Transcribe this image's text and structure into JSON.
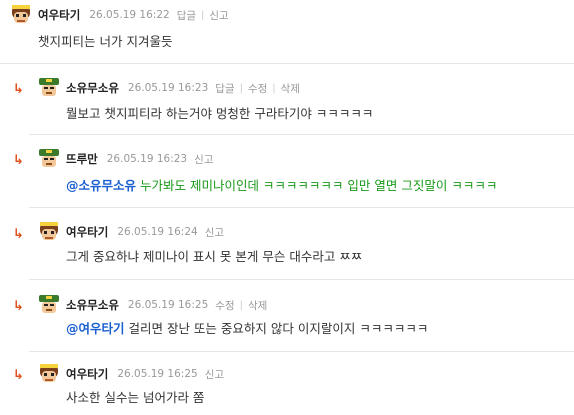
{
  "comments": [
    {
      "nick": "여우타기",
      "date": "26.05.19 16:22",
      "actions": [
        "답글",
        "신고"
      ],
      "text": "챗지피티는 너가 지겨울듯",
      "avatar": "fox"
    },
    {
      "nick": "소유무소유",
      "date": "26.05.19 16:23",
      "actions": [
        "답글",
        "수정",
        "삭제"
      ],
      "text": "뭘보고 챗지피티라 하는거야 멍청한 구라타기야 ㅋㅋㅋㅋㅋ",
      "avatar": "soldier"
    },
    {
      "nick": "뜨루만",
      "date": "26.05.19 16:23",
      "actions": [
        "신고"
      ],
      "mention": "@소유무소유",
      "text": " 누가봐도 제미나이인데 ㅋㅋㅋㅋㅋㅋㅋ 입만 열면 그짓말이 ㅋㅋㅋㅋ",
      "avatar": "soldier"
    },
    {
      "nick": "여우타기",
      "date": "26.05.19 16:24",
      "actions": [
        "신고"
      ],
      "text": "그게 중요하냐 제미나이 표시 못 본게 무슨 대수라고 ㅉㅉ",
      "avatar": "fox"
    },
    {
      "nick": "소유무소유",
      "date": "26.05.19 16:25",
      "actions": [
        "수정",
        "삭제"
      ],
      "mention": "@여우타기",
      "text": " 걸리면 장난 또는 중요하지 않다 이지랄이지 ㅋㅋㅋㅋㅋㅋ",
      "avatar": "soldier"
    },
    {
      "nick": "여우타기",
      "date": "26.05.19 16:25",
      "actions": [
        "신고"
      ],
      "text": "사소한 실수는 넘어가라 쫌",
      "avatar": "fox"
    }
  ],
  "reply_arrow": "↳",
  "colors": {
    "mention": "#1a5fd1",
    "green_text": "#1a9a1a",
    "reply_arrow": "#e0531e"
  }
}
